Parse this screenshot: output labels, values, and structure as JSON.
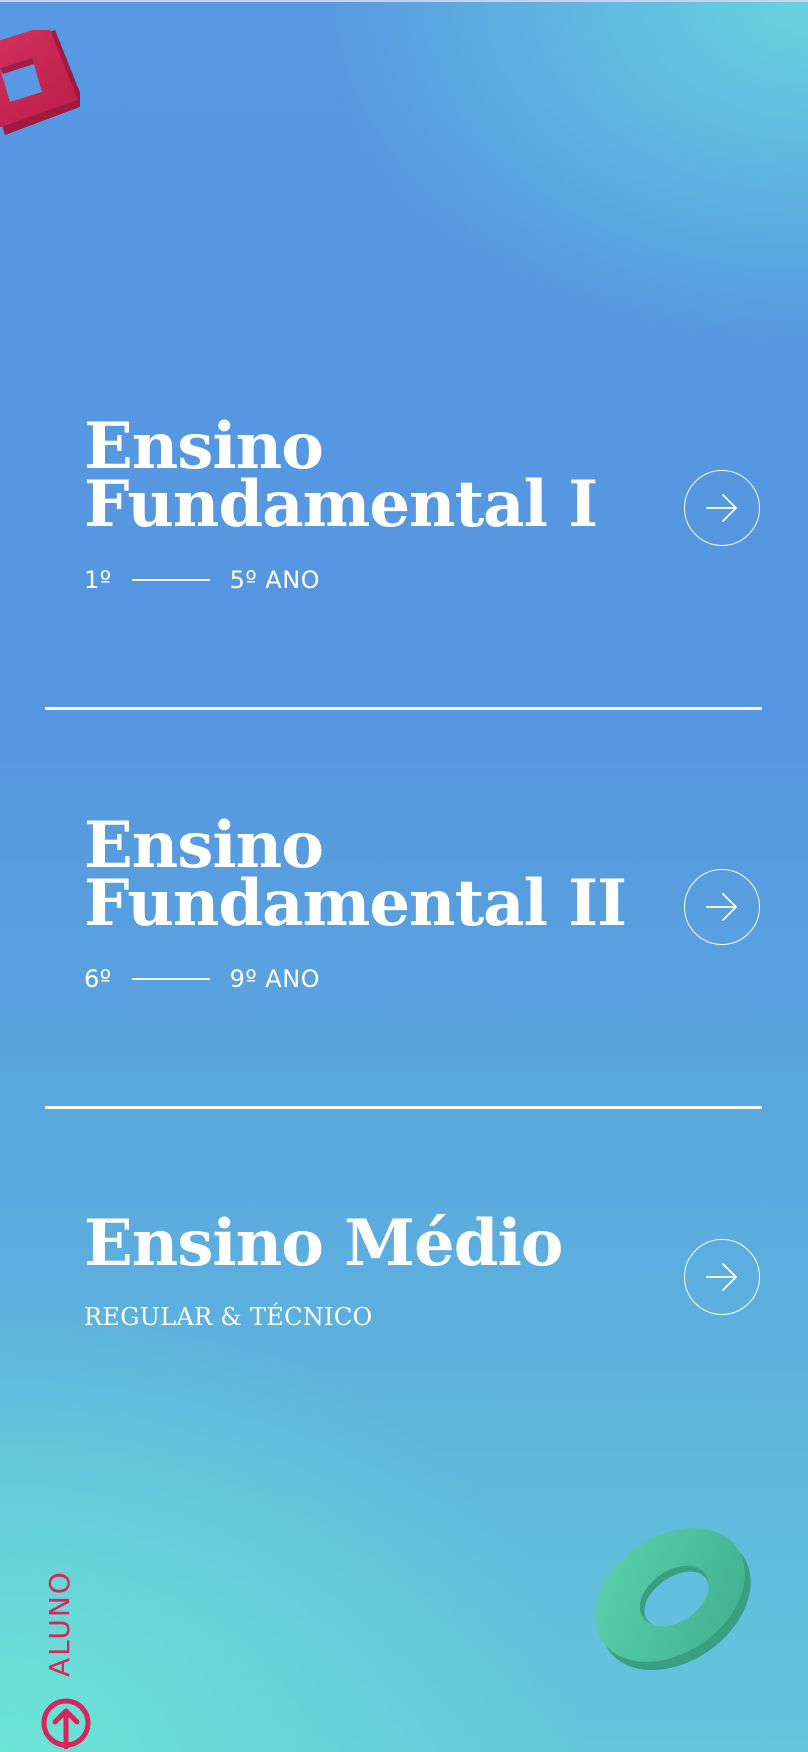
{
  "levels": [
    {
      "title_line1": "Ensino",
      "title_line2": "Fundamental I",
      "range_start": "1º",
      "range_end": "5º ANO"
    },
    {
      "title_line1": "Ensino",
      "title_line2": "Fundamental II",
      "range_start": "6º",
      "range_end": "9º ANO"
    },
    {
      "title_line1": "Ensino Médio",
      "subtitle": "REGULAR & TÉCNICO"
    }
  ],
  "side_link": {
    "label": "ALUNO",
    "icon": "arrow-up-circle-icon"
  },
  "icons": {
    "level_button": "arrow-right-icon",
    "decor_top": "square-frame-3d-icon",
    "decor_bottom": "ring-3d-icon"
  },
  "colors": {
    "accent": "#d8265a",
    "ring": "#4fc3a3",
    "text": "#ffffff"
  }
}
